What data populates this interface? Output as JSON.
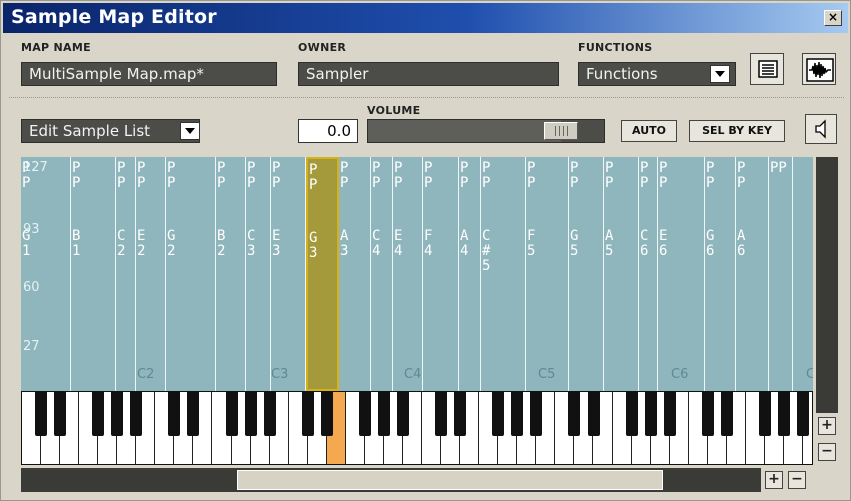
{
  "window": {
    "title": "Sample Map Editor",
    "close_glyph": "×"
  },
  "header": {
    "map_name_label": "MAP NAME",
    "map_name_value": "MultiSample Map.map*",
    "owner_label": "OWNER",
    "owner_value": "Sampler",
    "functions_label": "FUNCTIONS",
    "functions_value": "Functions",
    "list_icon": "list-view-icon",
    "waveform_icon": "waveform-icon"
  },
  "toolbar": {
    "edit_mode_value": "Edit Sample List",
    "volume_label": "VOLUME",
    "volume_value": "0.0",
    "volume_level": 0.87,
    "auto_label": "AUTO",
    "sel_by_key_label": "SEL BY KEY",
    "speaker_icon": "speaker-icon"
  },
  "map": {
    "velocity_labels": [
      "127",
      "93",
      "60",
      "27"
    ],
    "octave_labels": [
      "C2",
      "C3",
      "C4",
      "C5",
      "C6",
      "C"
    ],
    "zones": [
      {
        "top": "P P",
        "note": "G 1"
      },
      {
        "top": "P P",
        "note": "B 1"
      },
      {
        "top": "P P",
        "note": "C 2"
      },
      {
        "top": "P P",
        "note": "E 2"
      },
      {
        "top": "P P",
        "note": "G 2"
      },
      {
        "top": "P P",
        "note": "B 2"
      },
      {
        "top": "P P",
        "note": "C 3"
      },
      {
        "top": "P P",
        "note": "E 3"
      },
      {
        "top": "P P",
        "note": "G 3",
        "selected": true
      },
      {
        "top": "P P",
        "note": "A 3"
      },
      {
        "top": "P P",
        "note": "C 4"
      },
      {
        "top": "P P",
        "note": "E 4"
      },
      {
        "top": "P P",
        "note": "F 4"
      },
      {
        "top": "P P",
        "note": "A 4"
      },
      {
        "top": "P P",
        "note": "C # 5"
      },
      {
        "top": "P P",
        "note": "F 5"
      },
      {
        "top": "P P",
        "note": "G 5"
      },
      {
        "top": "P P",
        "note": "A 5"
      },
      {
        "top": "P P",
        "note": "C 6"
      },
      {
        "top": "P P",
        "note": "E 6"
      },
      {
        "top": "P P",
        "note": "G 6"
      },
      {
        "top": "P P",
        "note": "A 6"
      },
      {
        "top": "PP",
        "note": ""
      }
    ]
  },
  "scroll": {
    "plus": "+",
    "minus": "−"
  },
  "colors": {
    "map_bg": "#8fb6bd",
    "selected_zone": "#a49a3c",
    "active_key": "#f4a950",
    "title_bar": "#0a246a"
  }
}
